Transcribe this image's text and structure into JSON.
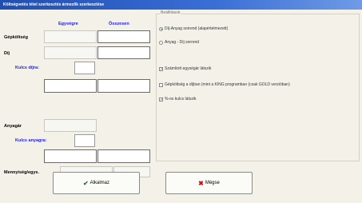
{
  "window": {
    "title": "Költségvetés tétel szerkesztés ármezők szerkesztése"
  },
  "columns": {
    "unit": "Egységre",
    "total": "Összesen"
  },
  "rows": {
    "gepkoltseg": "Gépköltség",
    "dij": "Díj",
    "kulcs_dijra": "Kulcs díjra:",
    "anyagar": "Anyagár",
    "kulcs_anyagra": "Kulcs anyagra:",
    "mennyiseg": "Mennyiség/egys."
  },
  "settings": {
    "title": "Beállítások",
    "radio_dij_anyag": "Díj-Anyag sorrend (alapértelmezett)",
    "radio_anyag_dij": "Anyag - Díj sorrend",
    "chk_szamitott": "Számított egységár látszik",
    "chk_gepkoltseg": "Gépköltség a díjban (mint a KING programban (csak GOLD verzióban)",
    "chk_kulcs": "%-os kulcs látszik"
  },
  "buttons": {
    "apply": "Alkalmaz",
    "cancel": "Mégse"
  },
  "colors": {
    "accent_blue": "#1a1aff",
    "ok_green": "#2a7a2a",
    "cancel_red": "#d01010"
  }
}
